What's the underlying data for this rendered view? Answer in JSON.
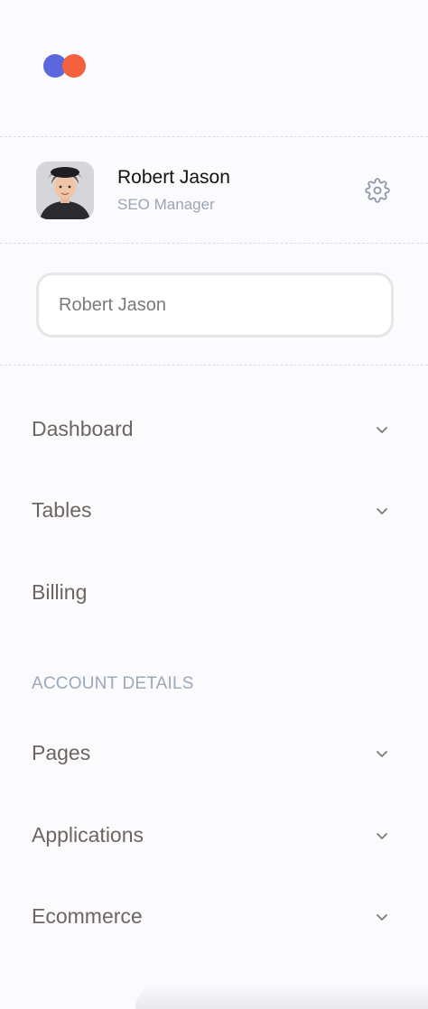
{
  "brand": {
    "logo_colors": [
      "#5b67dc",
      "#f4613d"
    ]
  },
  "profile": {
    "name": "Robert Jason",
    "role": "SEO Manager",
    "settings_icon": "gear-icon"
  },
  "search": {
    "value": "Robert Jason",
    "placeholder": ""
  },
  "nav": {
    "dashboard": "Dashboard",
    "tables": "Tables",
    "billing": "Billing",
    "section_title": "ACCOUNT DETAILS",
    "pages": "Pages",
    "applications": "Applications",
    "ecommerce": "Ecommerce",
    "expand_icon": "chevron-down-icon"
  }
}
